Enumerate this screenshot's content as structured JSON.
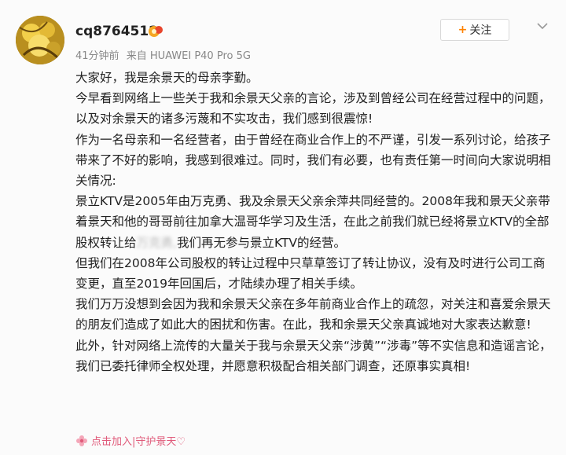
{
  "user": {
    "name": "cq8764512",
    "time": "41分钟前",
    "source": "来自 HUAWEI P40 Pro 5G"
  },
  "actions": {
    "follow_label": "关注"
  },
  "post": {
    "paragraphs": [
      "大家好，我是余景天的母亲李勤。",
      "今早看到网络上一些关于我和余景天父亲的言论，涉及到曾经公司在经营过程中的问题，以及对余景天的诸多污蔑和不实攻击，我们感到很震惊!",
      "作为一名母亲和一名经营者，由于曾经在商业合作上的不严谨，引发一系列讨论，给孩子带来了不好的影响，我感到很难过。同时，我们有必要，也有责任第一时间向大家说明相关情况:",
      "景立KTV是2005年由万克勇、我及余景天父亲余萍共同经营的。2008年我和景天父亲带着景天和他的哥哥前往加拿大温哥华学习及生活，在此之前我们就已经将景立KTV的全部股权转让给",
      "我们再无参与景立KTV的经营。",
      "但我们在2008年公司股权的转让过程中只草草签订了转让协议，没有及时进行公司工商变更，直至2019年回国后，才陆续办理了相关手续。",
      "我们万万没想到会因为我和余景天父亲在多年前商业合作上的疏忽，对关注和喜爱余景天的朋友们造成了如此大的困扰和伤害。在此，我和余景天父亲真诚地对大家表达歉意!",
      "此外，针对网络上流传的大量关于我与余景天父亲“涉黄”“涉毒”等不实信息和造谣言论，我们已委托律师全权处理，并愿意积极配合相关部门调查，还原事实真相!"
    ],
    "blurred": "万克勇,"
  },
  "footer": {
    "text": "点击加入|守护景天♡"
  },
  "icons": {
    "avatar": "avatar-image",
    "badge": "vip-badge-icon",
    "more": "chevron-down-icon",
    "footer": "flower-icon"
  },
  "colors": {
    "accent": "#ff8200",
    "footer_text": "#e05a7a"
  }
}
